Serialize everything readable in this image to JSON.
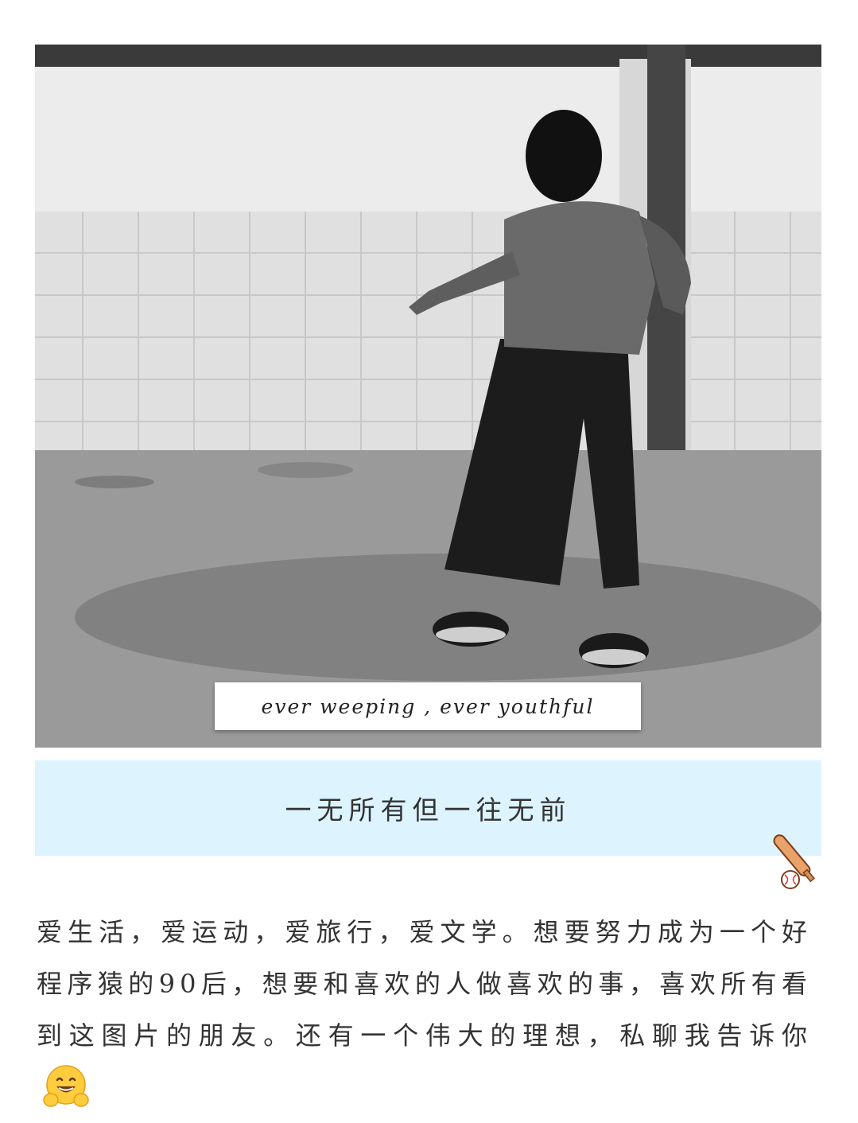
{
  "photo": {
    "caption": "ever weeping ,  ever youthful",
    "icon": "photo-girl-icon"
  },
  "banner": {
    "text": "一无所有但一往无前",
    "color": "#ddf4ff"
  },
  "decoration": {
    "icon": "baseball-bat-icon"
  },
  "bio": {
    "text": "爱生活，爱运动，爱旅行，爱文学。想要努力成为一个好程序猿的90后，想要和喜欢的人做喜欢的事，喜欢所有看到这图片的朋友。还有一个伟大的理想，私聊我告诉你",
    "emoji": "hugging-face-emoji-icon"
  }
}
